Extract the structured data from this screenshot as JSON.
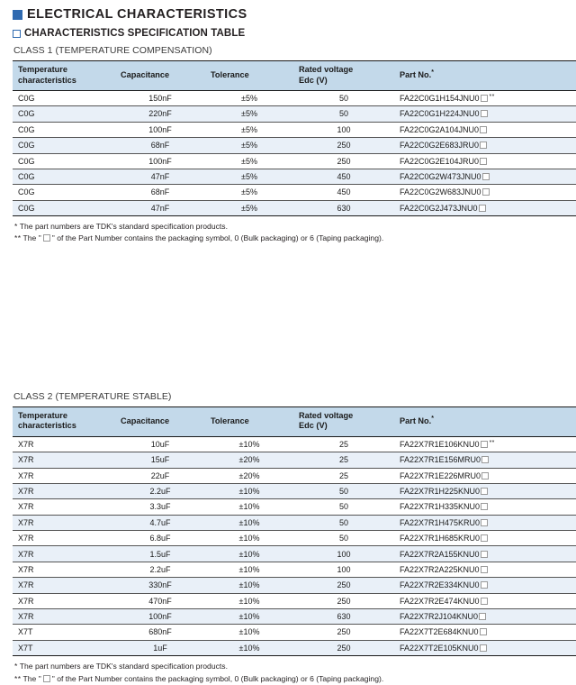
{
  "heading": {
    "title": "ELECTRICAL CHARACTERISTICS",
    "subtitle": "CHARACTERISTICS SPECIFICATION TABLE"
  },
  "columns": {
    "temperature_characteristics": "Temperature\ncharacteristics",
    "temperature_characteristics_line1": "Temperature",
    "temperature_characteristics_line2": "characteristics",
    "capacitance": "Capacitance",
    "tolerance": "Tolerance",
    "rated_voltage_line1": "Rated voltage",
    "rated_voltage_line2": "Edc (V)",
    "part_no": "Part No.",
    "part_no_marker": "*"
  },
  "notes": {
    "note1_marker": "*",
    "note1_text": "The part numbers are TDK's standard specification products.",
    "note2_marker": "**",
    "note2_prefix": "The \"",
    "note2_suffix": "\" of the Part Number contains the packaging symbol, 0 (Bulk packaging) or 6 (Taping packaging)."
  },
  "class1": {
    "label": "CLASS 1 (TEMPERATURE COMPENSATION)",
    "rows": [
      {
        "temp": "C0G",
        "cap": "150nF",
        "tol": "±5%",
        "volt": "50",
        "part": "FA22C0G1H154JNU0",
        "marker": "**"
      },
      {
        "temp": "C0G",
        "cap": "220nF",
        "tol": "±5%",
        "volt": "50",
        "part": "FA22C0G1H224JNU0",
        "marker": ""
      },
      {
        "temp": "C0G",
        "cap": "100nF",
        "tol": "±5%",
        "volt": "100",
        "part": "FA22C0G2A104JNU0",
        "marker": ""
      },
      {
        "temp": "C0G",
        "cap": "68nF",
        "tol": "±5%",
        "volt": "250",
        "part": "FA22C0G2E683JRU0",
        "marker": ""
      },
      {
        "temp": "C0G",
        "cap": "100nF",
        "tol": "±5%",
        "volt": "250",
        "part": "FA22C0G2E104JRU0",
        "marker": ""
      },
      {
        "temp": "C0G",
        "cap": "47nF",
        "tol": "±5%",
        "volt": "450",
        "part": "FA22C0G2W473JNU0",
        "marker": ""
      },
      {
        "temp": "C0G",
        "cap": "68nF",
        "tol": "±5%",
        "volt": "450",
        "part": "FA22C0G2W683JNU0",
        "marker": ""
      },
      {
        "temp": "C0G",
        "cap": "47nF",
        "tol": "±5%",
        "volt": "630",
        "part": "FA22C0G2J473JNU0",
        "marker": ""
      }
    ]
  },
  "class2": {
    "label": "CLASS 2 (TEMPERATURE STABLE)",
    "rows": [
      {
        "temp": "X7R",
        "cap": "10uF",
        "tol": "±10%",
        "volt": "25",
        "part": "FA22X7R1E106KNU0",
        "marker": "**"
      },
      {
        "temp": "X7R",
        "cap": "15uF",
        "tol": "±20%",
        "volt": "25",
        "part": "FA22X7R1E156MRU0",
        "marker": ""
      },
      {
        "temp": "X7R",
        "cap": "22uF",
        "tol": "±20%",
        "volt": "25",
        "part": "FA22X7R1E226MRU0",
        "marker": ""
      },
      {
        "temp": "X7R",
        "cap": "2.2uF",
        "tol": "±10%",
        "volt": "50",
        "part": "FA22X7R1H225KNU0",
        "marker": ""
      },
      {
        "temp": "X7R",
        "cap": "3.3uF",
        "tol": "±10%",
        "volt": "50",
        "part": "FA22X7R1H335KNU0",
        "marker": ""
      },
      {
        "temp": "X7R",
        "cap": "4.7uF",
        "tol": "±10%",
        "volt": "50",
        "part": "FA22X7R1H475KRU0",
        "marker": ""
      },
      {
        "temp": "X7R",
        "cap": "6.8uF",
        "tol": "±10%",
        "volt": "50",
        "part": "FA22X7R1H685KRU0",
        "marker": ""
      },
      {
        "temp": "X7R",
        "cap": "1.5uF",
        "tol": "±10%",
        "volt": "100",
        "part": "FA22X7R2A155KNU0",
        "marker": ""
      },
      {
        "temp": "X7R",
        "cap": "2.2uF",
        "tol": "±10%",
        "volt": "100",
        "part": "FA22X7R2A225KNU0",
        "marker": ""
      },
      {
        "temp": "X7R",
        "cap": "330nF",
        "tol": "±10%",
        "volt": "250",
        "part": "FA22X7R2E334KNU0",
        "marker": ""
      },
      {
        "temp": "X7R",
        "cap": "470nF",
        "tol": "±10%",
        "volt": "250",
        "part": "FA22X7R2E474KNU0",
        "marker": ""
      },
      {
        "temp": "X7R",
        "cap": "100nF",
        "tol": "±10%",
        "volt": "630",
        "part": "FA22X7R2J104KNU0",
        "marker": ""
      },
      {
        "temp": "X7T",
        "cap": "680nF",
        "tol": "±10%",
        "volt": "250",
        "part": "FA22X7T2E684KNU0",
        "marker": ""
      },
      {
        "temp": "X7T",
        "cap": "1uF",
        "tol": "±10%",
        "volt": "250",
        "part": "FA22X7T2E105KNU0",
        "marker": ""
      }
    ]
  },
  "colors": {
    "header_bg": "#c3d9ea",
    "row_alt_bg": "#e9f0f8",
    "accent_blue": "#2f6ab0",
    "text": "#231f20"
  }
}
